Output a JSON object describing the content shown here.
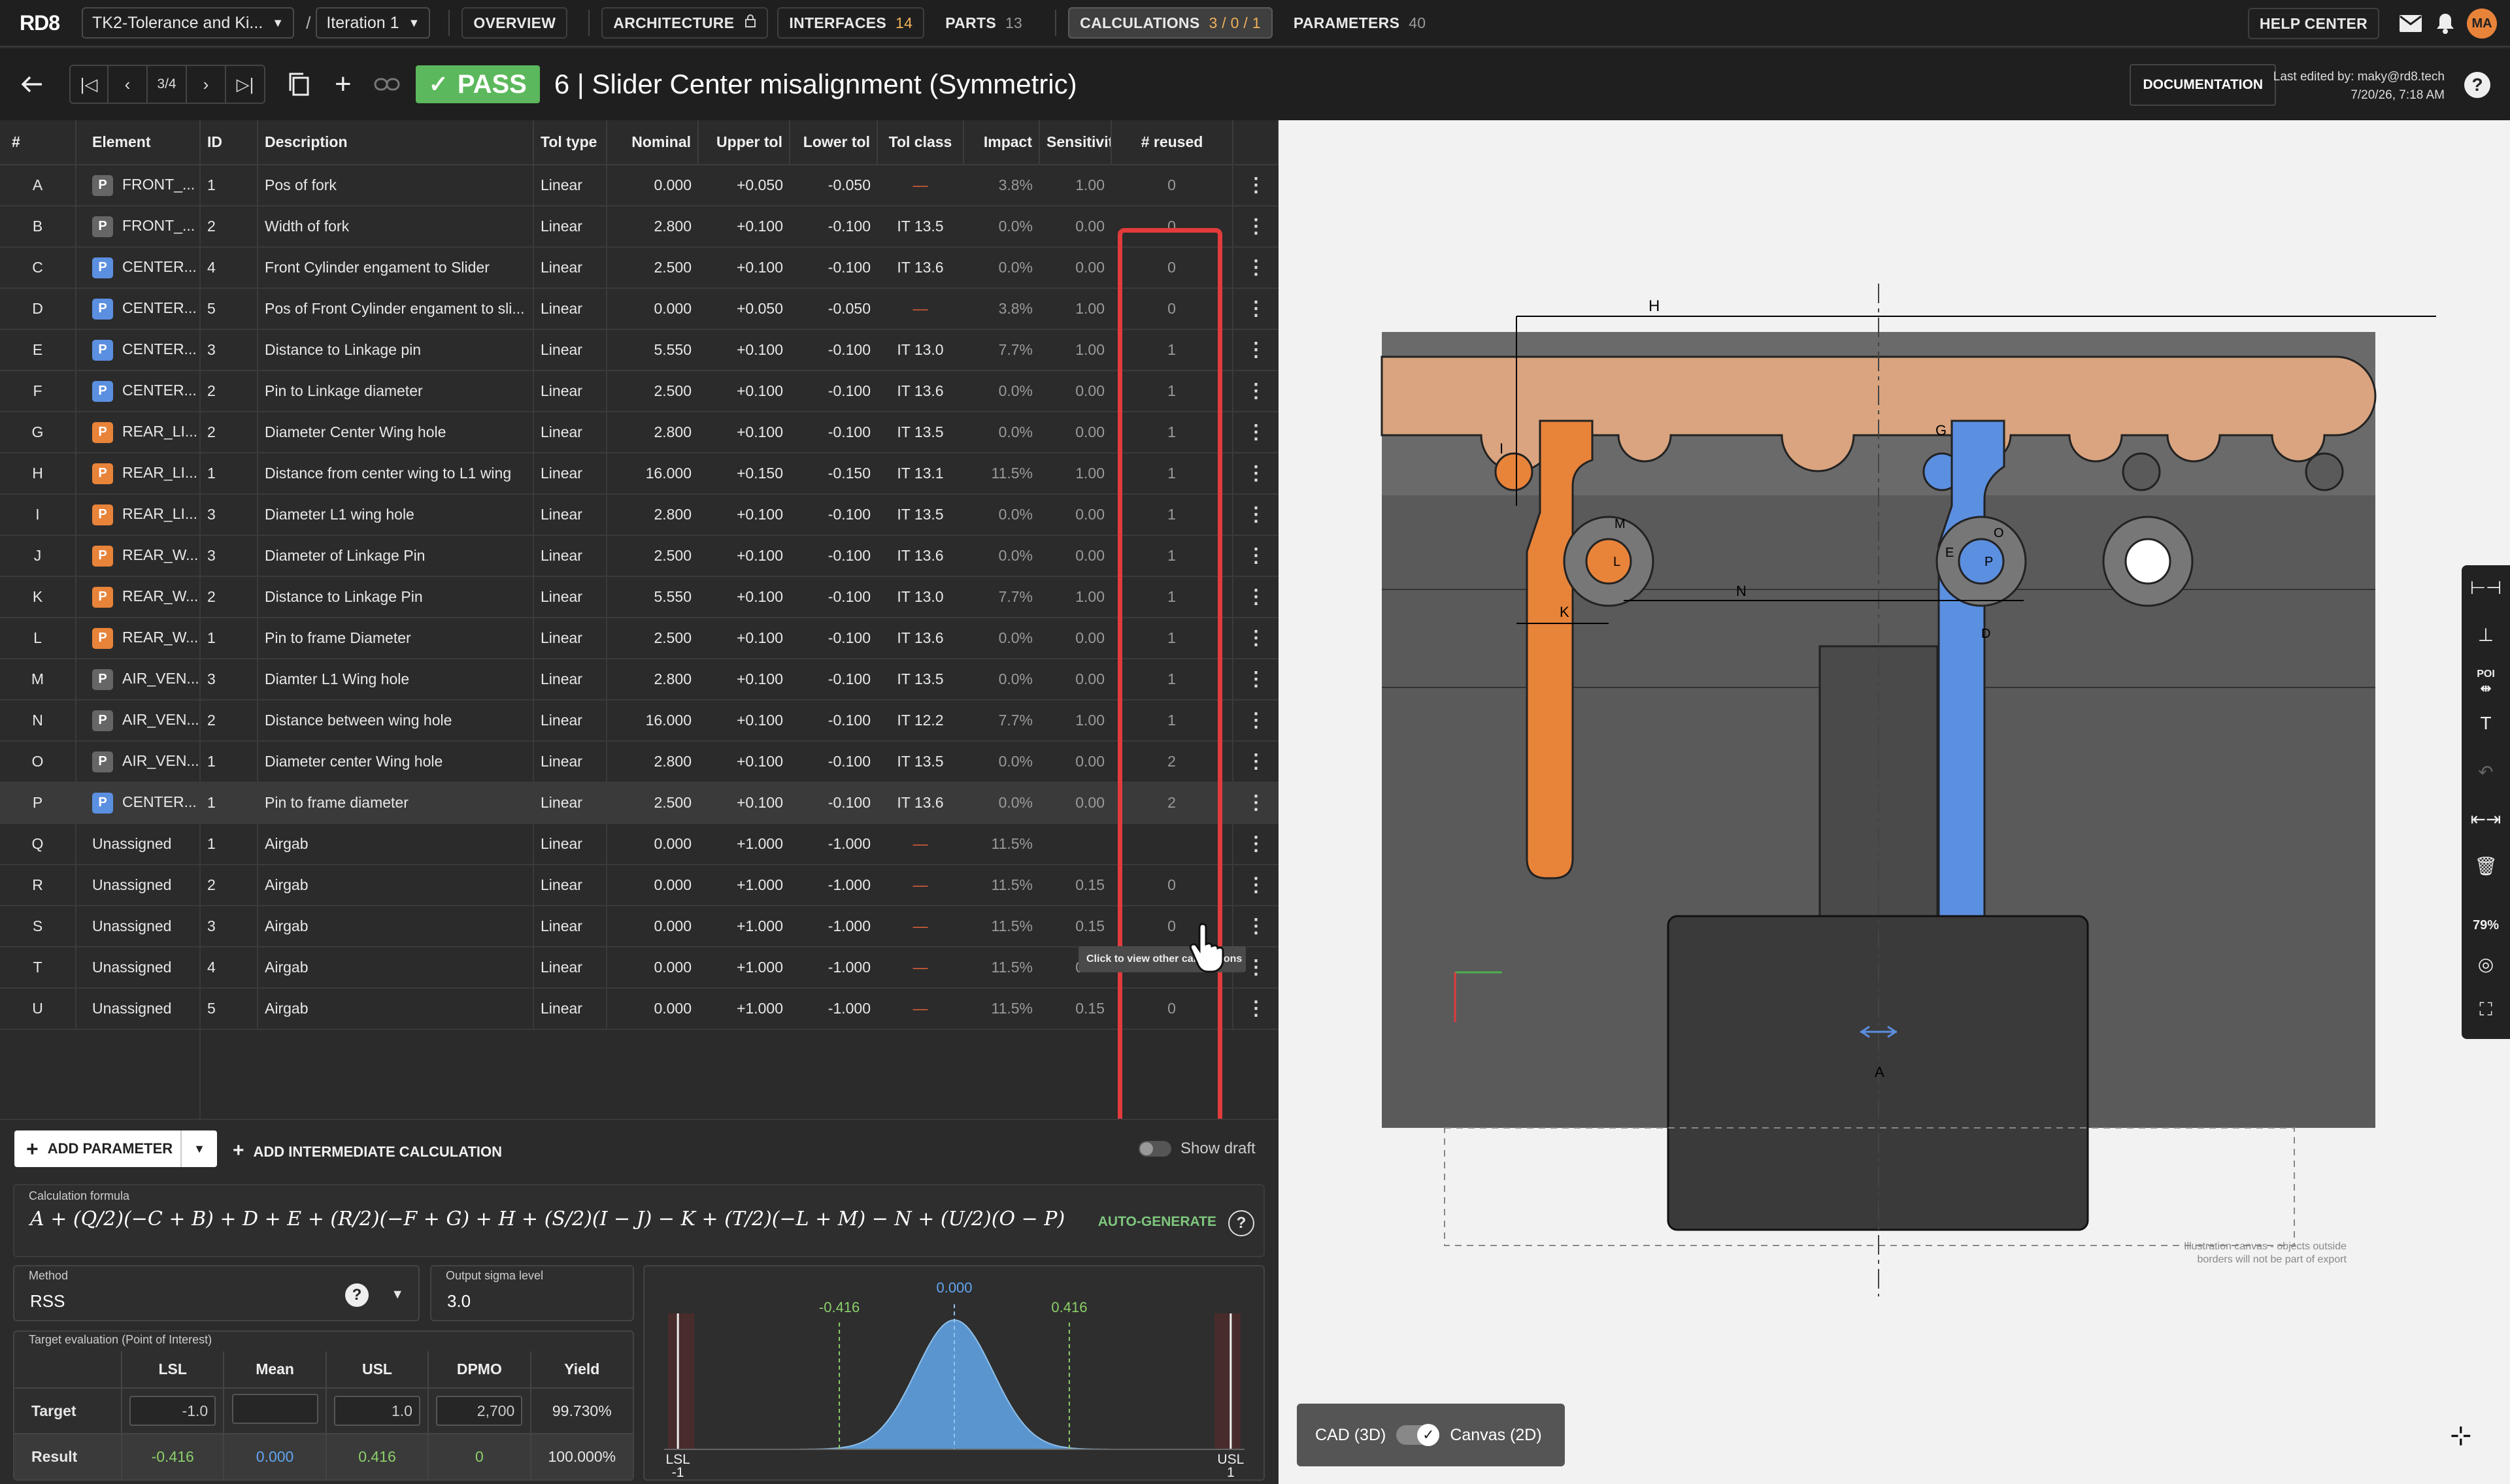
{
  "app": {
    "logo": "RD8"
  },
  "topbar": {
    "project": "TK2-Tolerance and Ki...",
    "iteration": "Iteration 1",
    "nav": [
      {
        "label": "OVERVIEW",
        "count": ""
      },
      {
        "label": "ARCHITECTURE",
        "count": ""
      },
      {
        "label": "INTERFACES",
        "count": "14"
      },
      {
        "label": "PARTS",
        "count": "13"
      },
      {
        "label": "CALCULATIONS",
        "count": "3 / 0 / 1"
      },
      {
        "label": "PARAMETERS",
        "count": "40"
      }
    ],
    "help_center": "HELP CENTER",
    "avatar": "MA"
  },
  "subbar": {
    "pager": "3/4",
    "status": "PASS",
    "title": "6 | Slider Center misalignment (Symmetric)",
    "documentation": "DOCUMENTATION",
    "last_edited_by": "Last edited by: maky@rd8.tech",
    "last_edited_at": "7/20/26, 7:18 AM"
  },
  "table": {
    "headers": [
      "#",
      "Element",
      "ID",
      "Description",
      "Tol type",
      "Nominal",
      "Upper tol",
      "Lower tol",
      "Tol class",
      "Impact",
      "Sensitivit",
      "# reused"
    ],
    "rows": [
      {
        "key": "A",
        "badge": "P",
        "color": "gray",
        "element": "FRONT_...",
        "id": "1",
        "desc": "Pos of fork",
        "type": "Linear",
        "nominal": "0.000",
        "upper": "+0.050",
        "lower": "-0.050",
        "cls": "—",
        "impact": "3.8%",
        "sens": "1.00",
        "reused": "0"
      },
      {
        "key": "B",
        "badge": "P",
        "color": "gray",
        "element": "FRONT_...",
        "id": "2",
        "desc": "Width of fork",
        "type": "Linear",
        "nominal": "2.800",
        "upper": "+0.100",
        "lower": "-0.100",
        "cls": "IT 13.5",
        "impact": "0.0%",
        "sens": "0.00",
        "reused": "0"
      },
      {
        "key": "C",
        "badge": "P",
        "color": "blue",
        "element": "CENTER...",
        "id": "4",
        "desc": "Front Cylinder engament to Slider",
        "type": "Linear",
        "nominal": "2.500",
        "upper": "+0.100",
        "lower": "-0.100",
        "cls": "IT 13.6",
        "impact": "0.0%",
        "sens": "0.00",
        "reused": "0"
      },
      {
        "key": "D",
        "badge": "P",
        "color": "blue",
        "element": "CENTER...",
        "id": "5",
        "desc": "Pos of Front Cylinder engament to sli...",
        "type": "Linear",
        "nominal": "0.000",
        "upper": "+0.050",
        "lower": "-0.050",
        "cls": "—",
        "impact": "3.8%",
        "sens": "1.00",
        "reused": "0"
      },
      {
        "key": "E",
        "badge": "P",
        "color": "blue",
        "element": "CENTER...",
        "id": "3",
        "desc": "Distance to Linkage pin",
        "type": "Linear",
        "nominal": "5.550",
        "upper": "+0.100",
        "lower": "-0.100",
        "cls": "IT 13.0",
        "impact": "7.7%",
        "sens": "1.00",
        "reused": "1"
      },
      {
        "key": "F",
        "badge": "P",
        "color": "blue",
        "element": "CENTER...",
        "id": "2",
        "desc": "Pin to Linkage diameter",
        "type": "Linear",
        "nominal": "2.500",
        "upper": "+0.100",
        "lower": "-0.100",
        "cls": "IT 13.6",
        "impact": "0.0%",
        "sens": "0.00",
        "reused": "1"
      },
      {
        "key": "G",
        "badge": "P",
        "color": "orange",
        "element": "REAR_LI...",
        "id": "2",
        "desc": "Diameter Center Wing hole",
        "type": "Linear",
        "nominal": "2.800",
        "upper": "+0.100",
        "lower": "-0.100",
        "cls": "IT 13.5",
        "impact": "0.0%",
        "sens": "0.00",
        "reused": "1"
      },
      {
        "key": "H",
        "badge": "P",
        "color": "orange",
        "element": "REAR_LI...",
        "id": "1",
        "desc": "Distance from center wing to L1 wing",
        "type": "Linear",
        "nominal": "16.000",
        "upper": "+0.150",
        "lower": "-0.150",
        "cls": "IT 13.1",
        "impact": "11.5%",
        "sens": "1.00",
        "reused": "1"
      },
      {
        "key": "I",
        "badge": "P",
        "color": "orange",
        "element": "REAR_LI...",
        "id": "3",
        "desc": "Diameter L1 wing hole",
        "type": "Linear",
        "nominal": "2.800",
        "upper": "+0.100",
        "lower": "-0.100",
        "cls": "IT 13.5",
        "impact": "0.0%",
        "sens": "0.00",
        "reused": "1"
      },
      {
        "key": "J",
        "badge": "P",
        "color": "orange",
        "element": "REAR_W...",
        "id": "3",
        "desc": "Diameter of Linkage Pin",
        "type": "Linear",
        "nominal": "2.500",
        "upper": "+0.100",
        "lower": "-0.100",
        "cls": "IT 13.6",
        "impact": "0.0%",
        "sens": "0.00",
        "reused": "1"
      },
      {
        "key": "K",
        "badge": "P",
        "color": "orange",
        "element": "REAR_W...",
        "id": "2",
        "desc": "Distance to Linkage Pin",
        "type": "Linear",
        "nominal": "5.550",
        "upper": "+0.100",
        "lower": "-0.100",
        "cls": "IT 13.0",
        "impact": "7.7%",
        "sens": "1.00",
        "reused": "1"
      },
      {
        "key": "L",
        "badge": "P",
        "color": "orange",
        "element": "REAR_W...",
        "id": "1",
        "desc": "Pin to frame Diameter",
        "type": "Linear",
        "nominal": "2.500",
        "upper": "+0.100",
        "lower": "-0.100",
        "cls": "IT 13.6",
        "impact": "0.0%",
        "sens": "0.00",
        "reused": "1"
      },
      {
        "key": "M",
        "badge": "P",
        "color": "gray",
        "element": "AIR_VEN...",
        "id": "3",
        "desc": "Diamter L1 Wing hole",
        "type": "Linear",
        "nominal": "2.800",
        "upper": "+0.100",
        "lower": "-0.100",
        "cls": "IT 13.5",
        "impact": "0.0%",
        "sens": "0.00",
        "reused": "1"
      },
      {
        "key": "N",
        "badge": "P",
        "color": "gray",
        "element": "AIR_VEN...",
        "id": "2",
        "desc": "Distance between wing hole",
        "type": "Linear",
        "nominal": "16.000",
        "upper": "+0.100",
        "lower": "-0.100",
        "cls": "IT 12.2",
        "impact": "7.7%",
        "sens": "1.00",
        "reused": "1"
      },
      {
        "key": "O",
        "badge": "P",
        "color": "gray",
        "element": "AIR_VEN...",
        "id": "1",
        "desc": "Diameter center Wing hole",
        "type": "Linear",
        "nominal": "2.800",
        "upper": "+0.100",
        "lower": "-0.100",
        "cls": "IT 13.5",
        "impact": "0.0%",
        "sens": "0.00",
        "reused": "2"
      },
      {
        "key": "P",
        "badge": "P",
        "color": "blue",
        "element": "CENTER...",
        "id": "1",
        "desc": "Pin to frame diameter",
        "type": "Linear",
        "nominal": "2.500",
        "upper": "+0.100",
        "lower": "-0.100",
        "cls": "IT 13.6",
        "impact": "0.0%",
        "sens": "0.00",
        "reused": "2"
      },
      {
        "key": "Q",
        "badge": "",
        "color": "",
        "element": "Unassigned",
        "id": "1",
        "desc": "Airgab",
        "type": "Linear",
        "nominal": "0.000",
        "upper": "+1.000",
        "lower": "-1.000",
        "cls": "—",
        "impact": "11.5%",
        "sens": "",
        "reused": ""
      },
      {
        "key": "R",
        "badge": "",
        "color": "",
        "element": "Unassigned",
        "id": "2",
        "desc": "Airgab",
        "type": "Linear",
        "nominal": "0.000",
        "upper": "+1.000",
        "lower": "-1.000",
        "cls": "—",
        "impact": "11.5%",
        "sens": "0.15",
        "reused": "0"
      },
      {
        "key": "S",
        "badge": "",
        "color": "",
        "element": "Unassigned",
        "id": "3",
        "desc": "Airgab",
        "type": "Linear",
        "nominal": "0.000",
        "upper": "+1.000",
        "lower": "-1.000",
        "cls": "—",
        "impact": "11.5%",
        "sens": "0.15",
        "reused": "0"
      },
      {
        "key": "T",
        "badge": "",
        "color": "",
        "element": "Unassigned",
        "id": "4",
        "desc": "Airgab",
        "type": "Linear",
        "nominal": "0.000",
        "upper": "+1.000",
        "lower": "-1.000",
        "cls": "—",
        "impact": "11.5%",
        "sens": "0.15",
        "reused": "0"
      },
      {
        "key": "U",
        "badge": "",
        "color": "",
        "element": "Unassigned",
        "id": "5",
        "desc": "Airgab",
        "type": "Linear",
        "nominal": "0.000",
        "upper": "+1.000",
        "lower": "-1.000",
        "cls": "—",
        "impact": "11.5%",
        "sens": "0.15",
        "reused": "0"
      }
    ],
    "tooltip": "Click to view other calculations"
  },
  "bottom": {
    "add_parameter": "ADD PARAMETER",
    "add_intermediate": "ADD INTERMEDIATE CALCULATION",
    "show_draft": "Show draft",
    "formula_label": "Calculation formula",
    "formula": "A + (Q/2)(−C + B) + D + E + (R/2)(−F + G) + H + (S/2)(I − J) − K + (T/2)(−L + M) − N + (U/2)(O − P)",
    "auto_generate": "AUTO-GENERATE",
    "method_label": "Method",
    "method_value": "RSS",
    "sigma_label": "Output sigma level",
    "sigma_value": "3.0",
    "target_label": "Target evaluation (Point of Interest)",
    "target_headers": [
      "",
      "LSL",
      "Mean",
      "USL",
      "DPMO",
      "Yield"
    ],
    "target_row": {
      "label": "Target",
      "lsl": "-1.0",
      "mean": "",
      "usl": "1.0",
      "dpmo": "2,700",
      "yield": "99.730%"
    },
    "result_row": {
      "label": "Result",
      "lsl": "-0.416",
      "mean": "0.000",
      "usl": "0.416",
      "dpmo": "0",
      "yield": "100.000%"
    }
  },
  "chart_data": {
    "type": "area",
    "title": "",
    "mean_label": "0.000",
    "lower_label": "-0.416",
    "upper_label": "0.416",
    "lsl_label": "LSL",
    "lsl_value": "-1",
    "usl_label": "USL",
    "usl_value": "1",
    "mean": 0.0,
    "lower": -0.416,
    "upper": 0.416,
    "lsl": -1,
    "usl": 1,
    "xlim": [
      -1.05,
      1.05
    ]
  },
  "canvas": {
    "labels": {
      "H": "H",
      "G": "G",
      "I": "I",
      "M": "M",
      "O": "O",
      "E": "E",
      "P": "P",
      "L": "L",
      "N": "N",
      "K": "K",
      "D": "D",
      "A": "A"
    },
    "note_line1": "Illustration canvas - objects outside",
    "note_line2": "borders will not be part of export",
    "cad_label": "CAD (3D)",
    "canvas_label": "Canvas (2D)",
    "zoom": "79%",
    "poi": "POI"
  },
  "colors": {
    "accent_orange": "#e8833a",
    "accent_blue": "#5b8fe0",
    "pass_green": "#5cb85c",
    "highlight_red": "#e23b3b"
  }
}
